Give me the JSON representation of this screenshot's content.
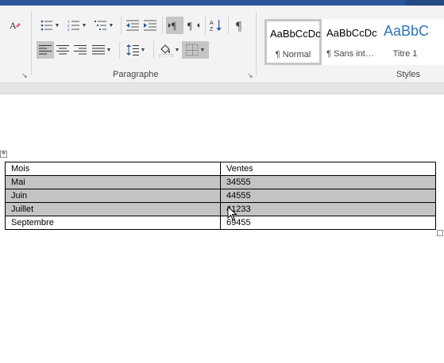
{
  "ribbon": {
    "paragraph_group": {
      "label": "Paragraphe"
    },
    "styles_group": {
      "label": "Styles"
    },
    "styles": [
      {
        "preview": "AaBbCcDc",
        "name": "¶ Normal",
        "selected": true
      },
      {
        "preview": "AaBbCcDc",
        "name": "¶ Sans int…",
        "selected": false
      },
      {
        "preview": "AaBbC",
        "name": "Titre 1",
        "selected": false
      }
    ],
    "icons": {
      "clear_formatting": "clear-formatting-icon",
      "bullets": "bullets-icon",
      "numbering": "numbering-icon",
      "multilevel": "multilevel-list-icon",
      "decrease_indent": "decrease-indent-icon",
      "increase_indent": "increase-indent-icon",
      "ltr": "left-to-right-icon",
      "rtl": "right-to-left-icon",
      "sort": "sort-icon",
      "pilcrow": "show-formatting-marks-icon",
      "align_left": "align-left-icon",
      "center": "center-icon",
      "align_right": "align-right-icon",
      "justify": "justify-icon",
      "line_spacing": "line-spacing-icon",
      "shading": "shading-icon",
      "borders": "borders-icon"
    },
    "colors": {
      "title_bar": "#2b579a",
      "ribbon_bg": "#f3f3f3",
      "active_button": "#c5c5c5",
      "heading_blue": "#2e74b5"
    }
  },
  "table": {
    "headers": [
      "Mois",
      "Ventes"
    ],
    "rows": [
      {
        "mois": "Mai",
        "ventes": "34555",
        "shaded": true
      },
      {
        "mois": "Juin",
        "ventes": "44555",
        "shaded": true
      },
      {
        "mois": "Juillet",
        "ventes": "41233",
        "shaded": true
      },
      {
        "mois": "Septembre",
        "ventes": "69455",
        "shaded": false
      }
    ],
    "shading_color": "#c4c4c4"
  }
}
